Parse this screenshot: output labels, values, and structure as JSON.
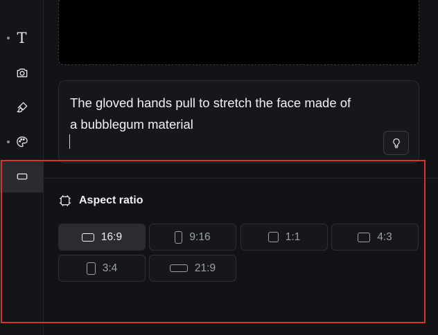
{
  "sidebar": {
    "items": [
      {
        "name": "text",
        "icon": "text-icon",
        "glyph": "T",
        "has_dot": true
      },
      {
        "name": "camera",
        "icon": "camera-icon",
        "has_dot": false
      },
      {
        "name": "brush",
        "icon": "brush-icon",
        "has_dot": false
      },
      {
        "name": "palette",
        "icon": "palette-icon",
        "has_dot": true
      },
      {
        "name": "aspect",
        "icon": "aspect-ratio-icon",
        "has_dot": false,
        "active": true
      }
    ]
  },
  "prompt": {
    "line1": "The gloved hands pull to stretch the face made of",
    "line2": "a bubblegum material"
  },
  "aspect": {
    "title": "Aspect ratio",
    "options": [
      {
        "label": "16:9",
        "selected": true
      },
      {
        "label": "9:16",
        "selected": false
      },
      {
        "label": "1:1",
        "selected": false
      },
      {
        "label": "4:3",
        "selected": false
      },
      {
        "label": "3:4",
        "selected": false
      },
      {
        "label": "21:9",
        "selected": false
      }
    ]
  },
  "colors": {
    "background": "#121316",
    "accent_selected": "#2b2c31",
    "highlight": "#e5302a"
  }
}
